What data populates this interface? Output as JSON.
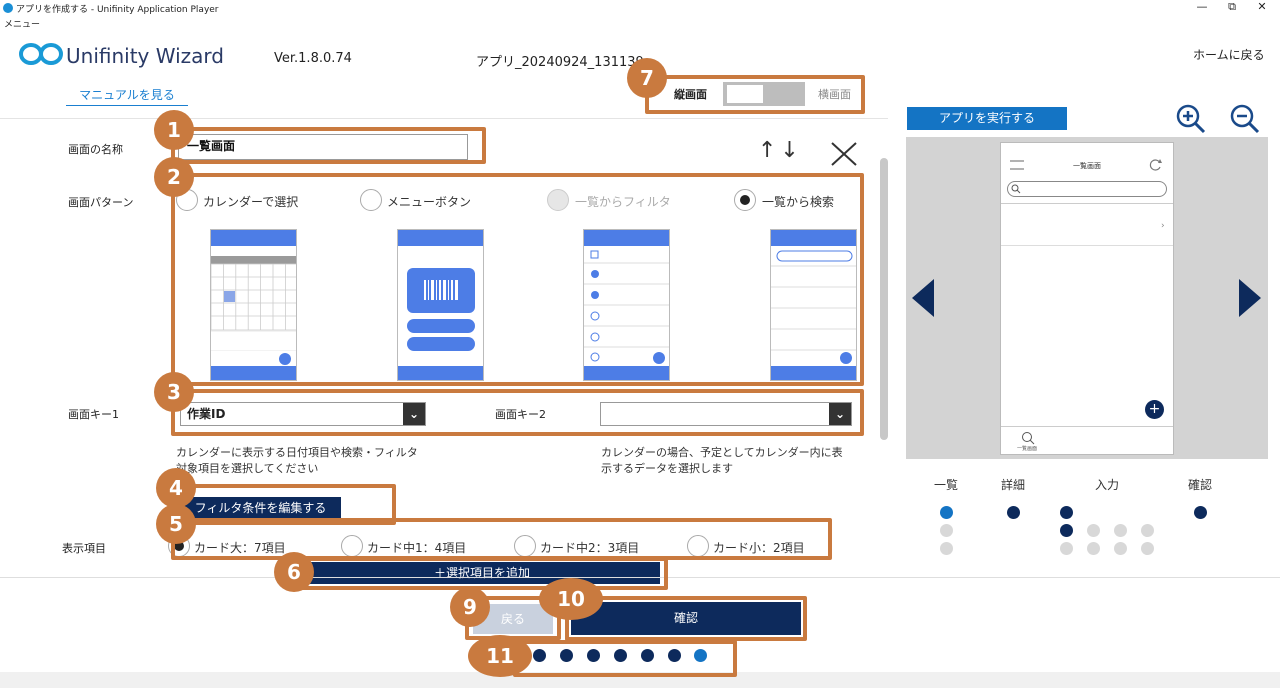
{
  "window": {
    "title": "アプリを作成する - Unifinity Application Player",
    "menu": "メニュー",
    "minimize_glyph": "—",
    "maximize_glyph": "⧉",
    "close_glyph": "✕"
  },
  "header": {
    "logo_text": "Unifinity Wizard",
    "version": "Ver.1.8.0.74",
    "app_name": "アプリ_20240924_131139",
    "home_link": "ホームに戻る",
    "manual_link": "マニュアルを見る"
  },
  "orientation": {
    "portrait": "縦画面",
    "landscape": "横画面"
  },
  "form": {
    "screen_name_label": "画面の名称",
    "screen_name_value": "一覧画面",
    "reorder_arrows": "↑↓",
    "screen_pattern_label": "画面パターン",
    "patterns": [
      {
        "label": "カレンダーで選択",
        "state": "unchecked"
      },
      {
        "label": "メニューボタン",
        "state": "unchecked"
      },
      {
        "label": "一覧からフィルタ",
        "state": "disabled"
      },
      {
        "label": "一覧から検索",
        "state": "checked"
      }
    ],
    "key1_label": "画面キー1",
    "key1_value": "作業ID",
    "key2_label": "画面キー2",
    "key2_value": "",
    "chevron_glyph": "⌄",
    "help1_line1": "カレンダーに表示する日付項目や検索・フィルタ",
    "help1_line2": "対象項目を選択してください",
    "help2_line1": "カレンダーの場合、予定としてカレンダー内に表",
    "help2_line2": "示するデータを選択します",
    "filter_button": "フィルタ条件を編集する",
    "display_items_label": "表示項目",
    "card_options": [
      {
        "label": "カード大：7項目",
        "state": "checked"
      },
      {
        "label": "カード中1：4項目",
        "state": "unchecked"
      },
      {
        "label": "カード中2：3項目",
        "state": "unchecked"
      },
      {
        "label": "カード小：2項目",
        "state": "unchecked"
      }
    ],
    "add_item_button": "＋選択項目を追加",
    "back_button": "戻る",
    "confirm_button": "確認"
  },
  "preview": {
    "run_button": "アプリを実行する",
    "phone_title": "一覧画面",
    "phone_footer": "一覧画面",
    "steps": [
      "一覧",
      "詳細",
      "入力",
      "確認"
    ],
    "plus_glyph": "+"
  },
  "badges": [
    "1",
    "2",
    "3",
    "4",
    "5",
    "6",
    "7",
    "9",
    "10",
    "11"
  ],
  "colors": {
    "accent_orange": "#c97a3f",
    "navy": "#0d2a5c",
    "blue": "#1474c4"
  }
}
